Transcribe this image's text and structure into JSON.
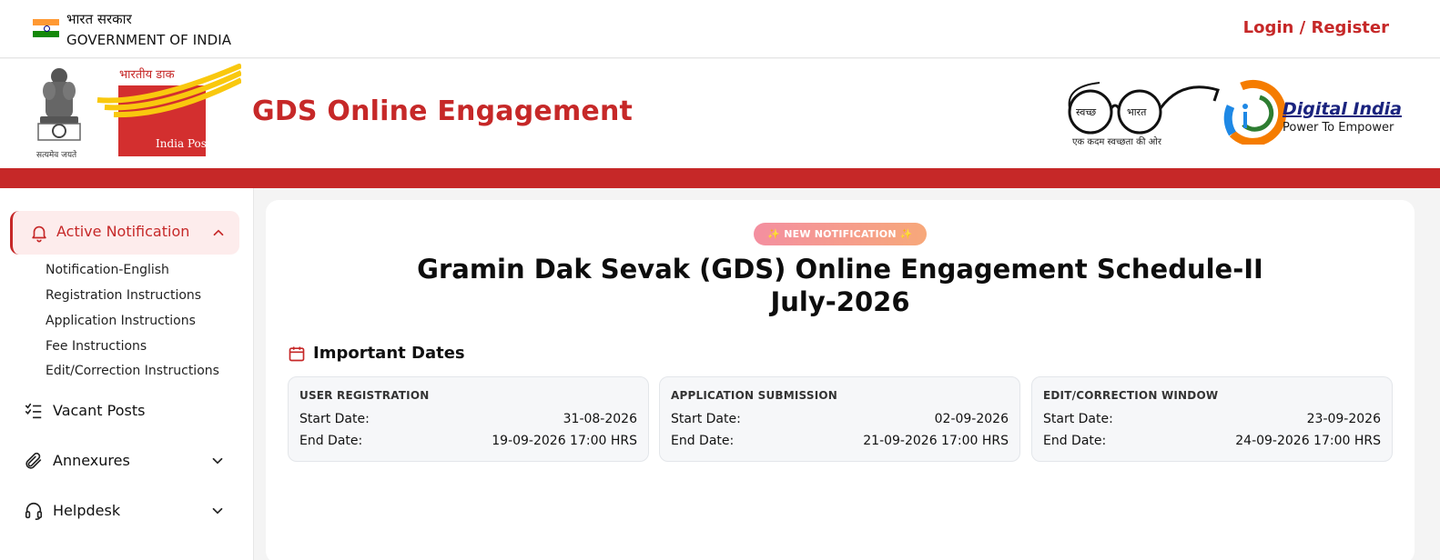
{
  "govbar": {
    "hindi": "भारत सरकार",
    "english": "GOVERNMENT OF INDIA",
    "login": "Login / Register"
  },
  "brand": {
    "emblem_caption": "सत्यमेव जयते",
    "site_title": "GDS Online Engagement",
    "swachh_caption": "एक कदम स्वच्छता की ओर",
    "digital_india_title": "Digital India",
    "digital_india_sub": "Power To Empower"
  },
  "sidebar": {
    "active": "Active Notification",
    "sub_items": [
      "Notification-English",
      "Registration Instructions",
      "Application Instructions",
      "Fee Instructions",
      "Edit/Correction Instructions"
    ],
    "items": [
      "Vacant Posts",
      "Annexures",
      "Helpdesk"
    ]
  },
  "main": {
    "badge": "✨ NEW NOTIFICATION ✨",
    "title_line1": "Gramin Dak Sevak (GDS) Online Engagement Schedule-II",
    "title_line2": "July-2026",
    "dates_heading": "Important Dates",
    "start_label": "Start Date:",
    "end_label": "End Date:",
    "boxes": [
      {
        "heading": "USER REGISTRATION",
        "start": "31-08-2026",
        "end": "19-09-2026 17:00 HRS"
      },
      {
        "heading": "APPLICATION SUBMISSION",
        "start": "02-09-2026",
        "end": "21-09-2026 17:00 HRS"
      },
      {
        "heading": "EDIT/CORRECTION WINDOW",
        "start": "23-09-2026",
        "end": "24-09-2026 17:00 HRS"
      }
    ]
  },
  "colors": {
    "accent": "#c62828",
    "badge_start": "#f48fa0",
    "badge_end": "#f7a87a"
  }
}
